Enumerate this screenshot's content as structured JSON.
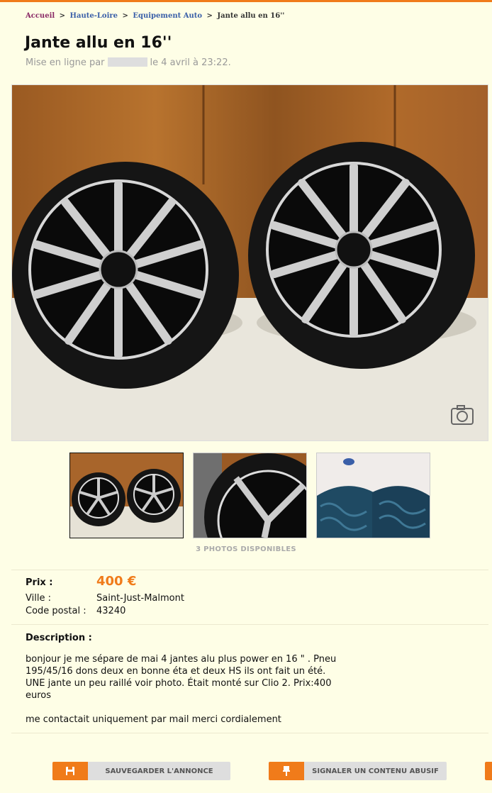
{
  "breadcrumb": {
    "home": "Accueil",
    "region": "Haute-Loire",
    "category": "Equipement Auto",
    "current": "Jante allu en 16''",
    "separator": ">"
  },
  "ad": {
    "title": "Jante allu en 16''",
    "posted_prefix": "Mise en ligne par",
    "posted_suffix": "le 4 avril à 23:22."
  },
  "photos": {
    "count_label": "3 PHOTOS DISPONIBLES"
  },
  "details": {
    "price_label": "Prix :",
    "price_value": "400 €",
    "city_label": "Ville :",
    "city_value": "Saint-Just-Malmont",
    "postcode_label": "Code postal :",
    "postcode_value": "43240"
  },
  "description": {
    "label": "Description :",
    "paragraph1": "bonjour je me sépare de mai 4 jantes alu plus power en 16 \" . Pneu 195/45/16 dons deux en bonne éta et deux HS ils ont fait un été. UNE jante un peu raillé voir photo. Était monté sur Clio 2. Prix:400 euros",
    "paragraph2": "me contactait uniquement par mail merci cordialement"
  },
  "actions": {
    "save_label": "SAUVEGARDER L'ANNONCE",
    "report_label": "SIGNALER UN CONTENU ABUSIF"
  },
  "colors": {
    "accent": "#f07b1a",
    "background": "#fefee6",
    "price": "#f07b1a"
  },
  "icons": {
    "save": "floppy-disk-icon",
    "report": "pin-icon",
    "photo_overlay": "camera-icon"
  }
}
